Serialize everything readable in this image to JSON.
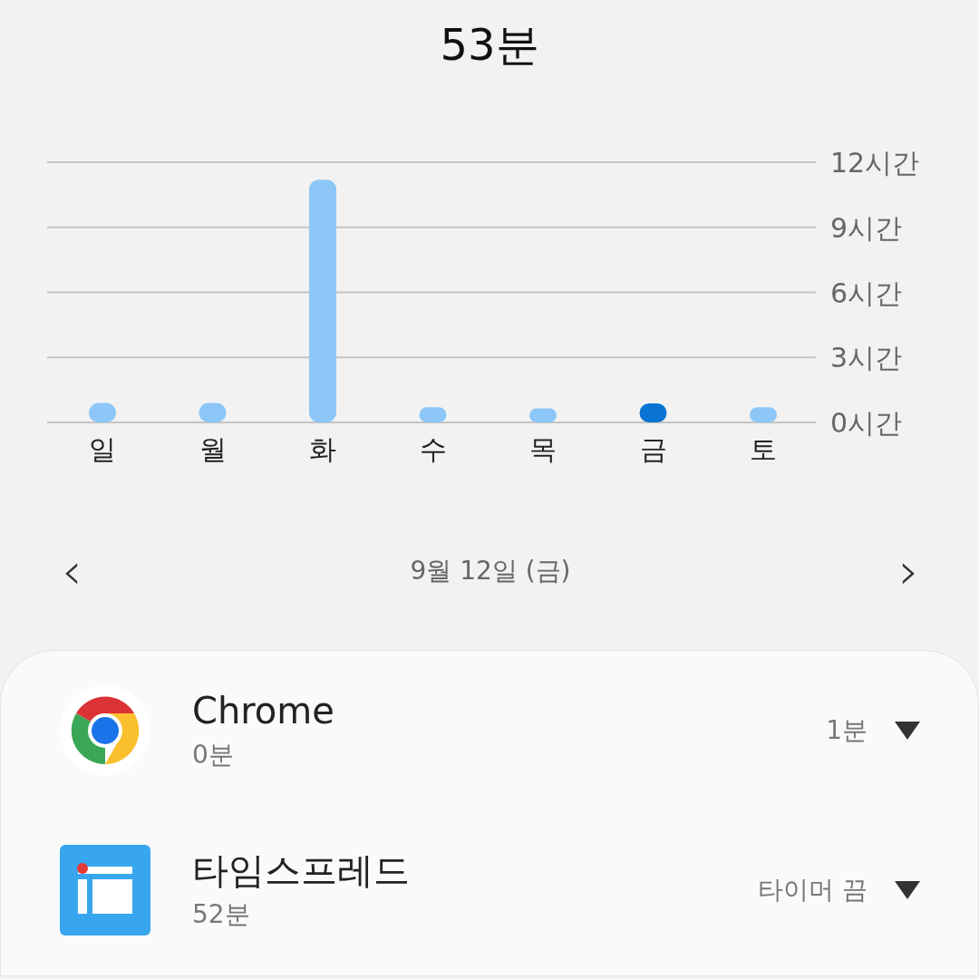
{
  "title": "53분",
  "usage_chart": {
    "chart_data": {
      "type": "bar",
      "grid": true,
      "categories": [
        "일",
        "월",
        "화",
        "수",
        "목",
        "금",
        "토"
      ],
      "series": [
        {
          "color": "#8cc7f7",
          "values": [
            0.9,
            0.9,
            11.2,
            0.7,
            0.65,
            null,
            0.7
          ]
        },
        {
          "color": "#0a74d4",
          "values": [
            null,
            null,
            null,
            null,
            null,
            0.88,
            null
          ]
        }
      ],
      "ylim": [
        0,
        12
      ],
      "yticks": [
        {
          "value": 0,
          "label": "0시간"
        },
        {
          "value": 3,
          "label": "3시간"
        },
        {
          "value": 6,
          "label": "6시간"
        },
        {
          "value": 9,
          "label": "9시간"
        },
        {
          "value": 12,
          "label": "12시간"
        }
      ]
    }
  },
  "date_nav": {
    "prev": "‹",
    "date": "9월 12일 (금)",
    "next": "›"
  },
  "apps": [
    {
      "kind": "chrome",
      "name": "Chrome",
      "usage": "0분",
      "timer": "1분"
    },
    {
      "kind": "timespread",
      "name": "타임스프레드",
      "usage": "52분",
      "timer": "타이머 끔"
    }
  ]
}
